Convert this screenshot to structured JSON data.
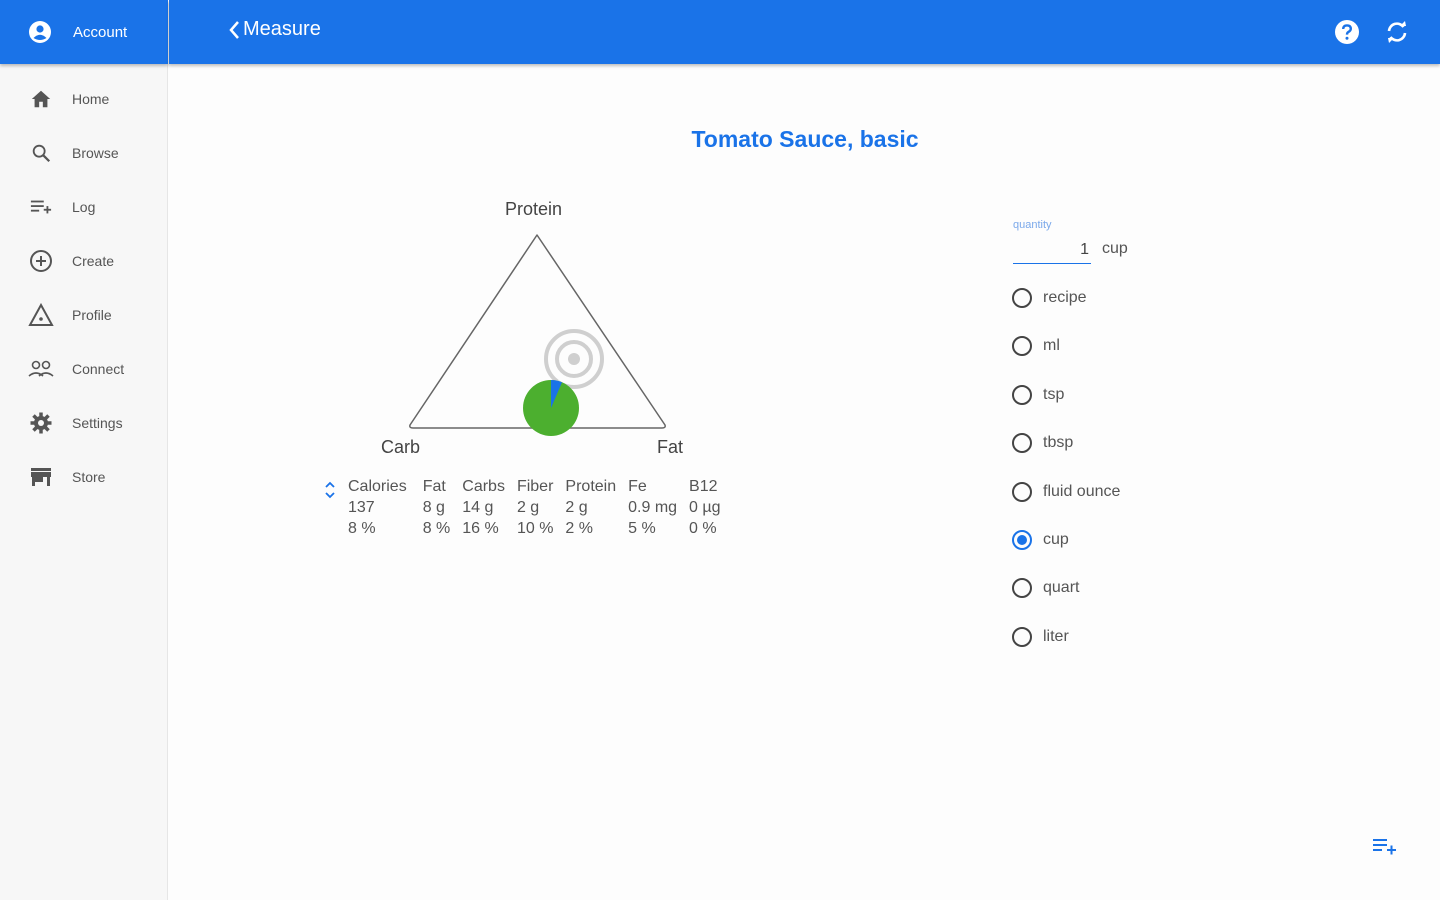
{
  "sidebar": {
    "account_label": "Account",
    "items": [
      {
        "label": "Home",
        "icon": "home-icon"
      },
      {
        "label": "Browse",
        "icon": "search-icon"
      },
      {
        "label": "Log",
        "icon": "playlist-add-icon"
      },
      {
        "label": "Create",
        "icon": "add-circle-icon"
      },
      {
        "label": "Profile",
        "icon": "triangle-alert-icon"
      },
      {
        "label": "Connect",
        "icon": "people-icon"
      },
      {
        "label": "Settings",
        "icon": "gear-icon"
      },
      {
        "label": "Store",
        "icon": "store-icon"
      }
    ]
  },
  "header": {
    "back_label": "Measure",
    "help_icon": "help-icon",
    "sync_icon": "sync-icon"
  },
  "food": {
    "title": "Tomato Sauce, basic"
  },
  "triangle": {
    "top_label": "Protein",
    "left_label": "Carb",
    "right_label": "Fat",
    "marker_colors": {
      "carb": "#4caf2f",
      "protein": "#1a73e8"
    }
  },
  "nutrients": {
    "headers": [
      "Calories",
      "Fat",
      "Carbs",
      "Fiber",
      "Protein",
      "Fe",
      "B12"
    ],
    "amounts": [
      "137",
      "8 g",
      "14 g",
      "2 g",
      "2 g",
      "0.9 mg",
      "0 µg"
    ],
    "percents": [
      "8 %",
      "8 %",
      "16 %",
      "10 %",
      "2 %",
      "5 %",
      "0 %"
    ]
  },
  "quantity": {
    "label": "quantity",
    "value": "1",
    "unit": "cup"
  },
  "units": {
    "options": [
      "recipe",
      "ml",
      "tsp",
      "tbsp",
      "fluid ounce",
      "cup",
      "quart",
      "liter"
    ],
    "selected": "cup"
  },
  "colors": {
    "primary": "#1a73e8",
    "carb_marker": "#4caf2f"
  }
}
